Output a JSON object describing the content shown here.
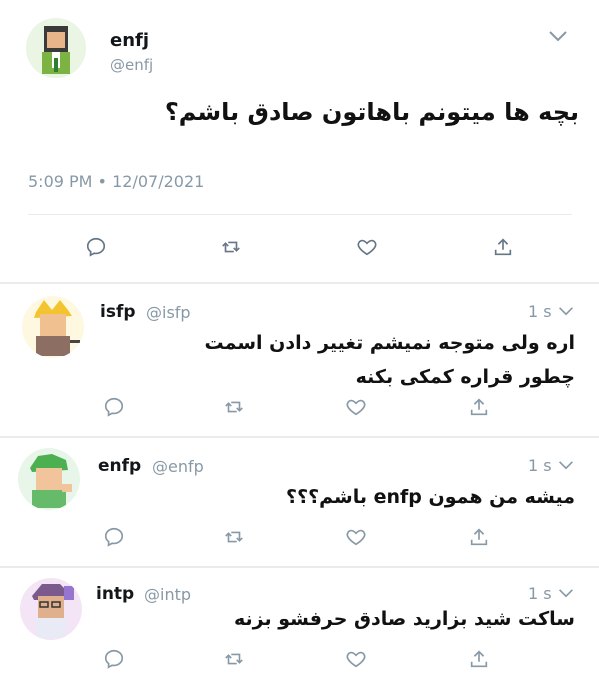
{
  "main_tweet": {
    "name": "enfj",
    "handle": "@enfj",
    "text": "بچه ها میتونم باهاتون صادق باشم؟",
    "timestamp": "5:09 PM • 12/07/2021"
  },
  "replies": [
    {
      "name": "isfp",
      "handle": "@isfp",
      "time": "1 s",
      "lines": [
        "اره ولی متوجه نمیشم تغییر دادن اسمت",
        "چطور قراره کمکی بکنه"
      ]
    },
    {
      "name": "enfp",
      "handle": "@enfp",
      "time": "1 s",
      "lines": [
        "میشه من همون enfp باشم؟؟؟"
      ]
    },
    {
      "name": "intp",
      "handle": "@intp",
      "time": "1 s",
      "lines": [
        "ساکت شید بزارید صادق حرفشو بزنه"
      ]
    }
  ],
  "icons": {
    "reply": "speech-bubble-icon",
    "retweet": "retweet-icon",
    "like": "heart-icon",
    "share": "share-icon",
    "menu": "chevron-down-icon"
  },
  "colors": {
    "muted": "#8899a6",
    "divider": "#e6ecf0",
    "text": "#14171a"
  }
}
